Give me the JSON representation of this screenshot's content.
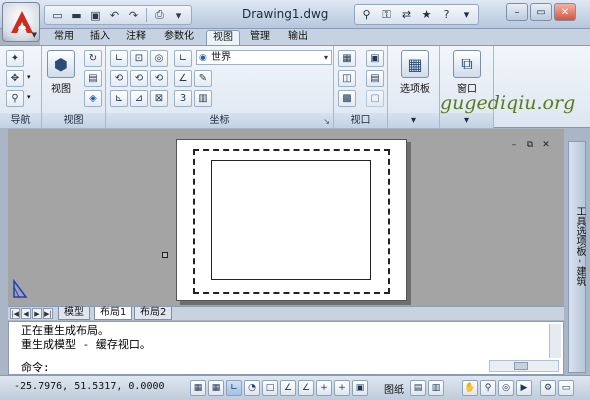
{
  "title_bar": {
    "document_title": "Drawing1.dwg",
    "qat_icons": [
      "new-icon",
      "open-icon",
      "save-icon",
      "undo-icon",
      "redo-icon",
      "print-icon"
    ],
    "info_icons": [
      "binoculars-icon",
      "key-icon",
      "exchange-icon",
      "star-icon",
      "help-icon"
    ]
  },
  "tabs": [
    "常用",
    "插入",
    "注释",
    "参数化",
    "视图",
    "管理",
    "输出"
  ],
  "active_tab": "视图",
  "ribbon": {
    "panels": {
      "navigate": "导航",
      "view": "视图",
      "coords": "坐标",
      "viewport": "视口",
      "palettes_label": "选项板",
      "window_label": "窗口"
    },
    "view_button": "视图",
    "ucs_dropdown": "世界"
  },
  "watermark": "gugediqiu.org",
  "tool_palette_label": "工具选项板 - 建筑",
  "layout_tabs": [
    "模型",
    "布局1",
    "布局2"
  ],
  "active_layout": "布局1",
  "command": {
    "line1": "正在重生成布局。",
    "line2": "重生成模型 - 缓存视口。",
    "prompt": "命令:"
  },
  "status": {
    "coordinates": "-25.7976, 51.5317, 0.0000",
    "paper_label": "图纸"
  },
  "colors": {
    "canvas": "#a4a4a4",
    "ribbon": "#dde6f1",
    "accent": "#1b5fb2"
  }
}
